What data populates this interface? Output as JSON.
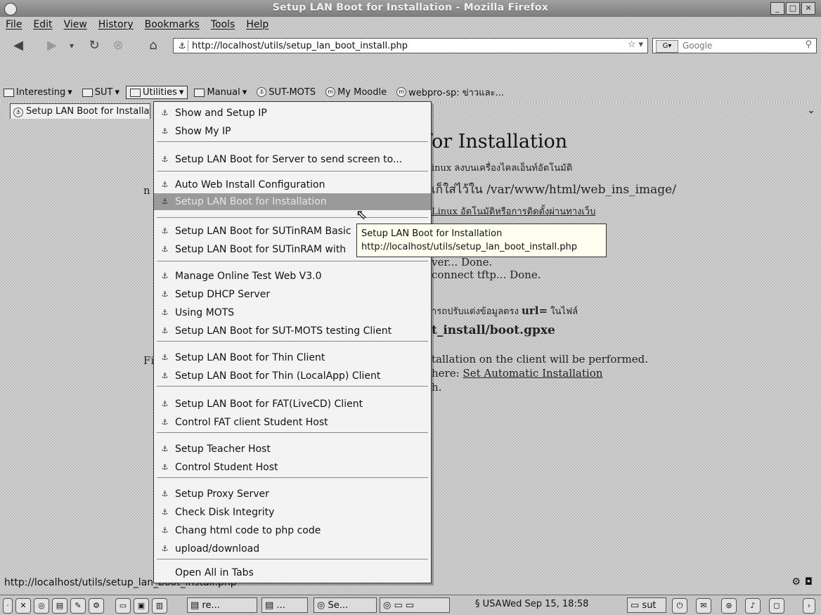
{
  "window": {
    "title": "Setup LAN Boot for Installation - Mozilla Firefox"
  },
  "menubar": [
    "File",
    "Edit",
    "View",
    "History",
    "Bookmarks",
    "Tools",
    "Help"
  ],
  "navigation": {
    "url": "http://localhost/utils/setup_lan_boot_install.php",
    "search_placeholder": "Google"
  },
  "bookmarks": [
    {
      "label": "Interesting",
      "type": "folder"
    },
    {
      "label": "SUT",
      "type": "folder"
    },
    {
      "label": "Utilities",
      "type": "folder",
      "active": true
    },
    {
      "label": "Manual",
      "type": "folder"
    },
    {
      "label": "SUT-MOTS",
      "type": "link"
    },
    {
      "label": "My Moodle",
      "type": "link"
    },
    {
      "label": "webpro-sp: ข่าวและ...",
      "type": "link"
    }
  ],
  "tab": {
    "label": "Setup LAN Boot for Installation"
  },
  "page": {
    "heading": "for Installation",
    "line1": "inux ลงบนเครื่องไคลเอ็นท์อัตโนมัติ",
    "line2": "เก็ใส่ไว้ใน /var/www/html/web_ins_image/",
    "line3": "Linux อัตโนมัติหรือการติดตั้งผ่านทางเว็บ",
    "line4": "ver... Done.",
    "line5": "connect tftp... Done.",
    "line6a": "ารถปรับแต่งข้อมูลตรง",
    "line6b": "url=",
    "line6c": "ในไฟล์",
    "line7": "t_install/boot.gpxe",
    "line8": "tallation on the client will be performed.",
    "line9a": "here:",
    "line9b": "Set Automatic Installation",
    "line10": "h.",
    "left_frag1": "n",
    "left_frag2": "Fi"
  },
  "menu": {
    "items": [
      "Show and Setup IP",
      "Show My IP",
      "Setup LAN Boot for Server to send screen to...",
      "Auto Web Install Configuration",
      "Setup LAN Boot for Installation",
      "Setup LAN Boot for SUTinRAM Basic",
      "Setup LAN Boot for SUTinRAM with",
      "Manage Online Test Web V3.0",
      "Setup DHCP Server",
      "Using MOTS",
      "Setup LAN Boot for SUT-MOTS testing Client",
      "Setup LAN Boot for Thin Client",
      "Setup LAN Boot for Thin (LocalApp) Client",
      "Setup LAN Boot for FAT(LiveCD) Client",
      "Control FAT client Student Host",
      "Setup Teacher Host",
      "Control Student Host",
      "Setup Proxy Server",
      "Check Disk Integrity",
      "Chang html code to php code",
      "upload/download"
    ],
    "open_all": "Open All in Tabs",
    "highlighted_index": 4
  },
  "tooltip": {
    "title": "Setup LAN Boot for Installation",
    "url": "http://localhost/utils/setup_lan_boot_install.php"
  },
  "statusbar": {
    "url": "http://localhost/utils/setup_lan_boot_install.php"
  },
  "taskbar": {
    "tasks": [
      "re...",
      "...",
      "Se..."
    ],
    "locale": "USA",
    "clock": "Wed Sep 15, 18:58",
    "user": "sut"
  }
}
